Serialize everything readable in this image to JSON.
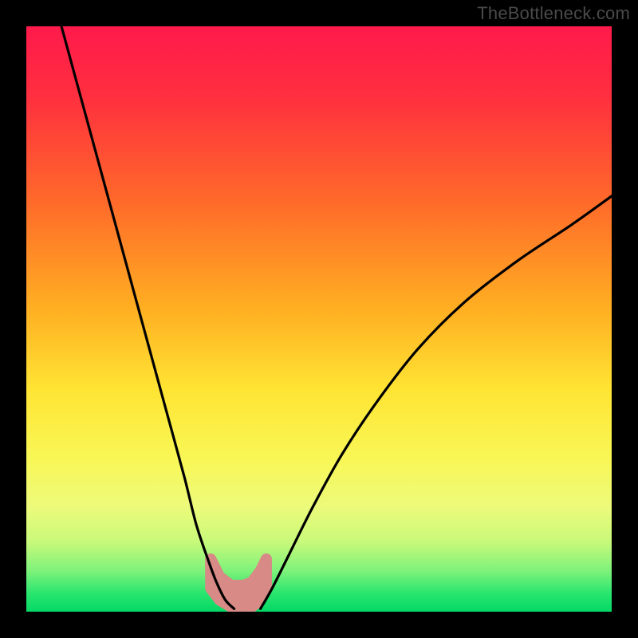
{
  "watermark": "TheBottleneck.com",
  "chart_data": {
    "type": "line",
    "title": "",
    "xlabel": "",
    "ylabel": "",
    "xlim": [
      0,
      100
    ],
    "ylim": [
      0,
      100
    ],
    "gradient_stops": [
      {
        "offset": 0.0,
        "color": "#ff1a4b"
      },
      {
        "offset": 0.12,
        "color": "#ff2f3f"
      },
      {
        "offset": 0.3,
        "color": "#ff6a2a"
      },
      {
        "offset": 0.48,
        "color": "#ffae22"
      },
      {
        "offset": 0.62,
        "color": "#ffe433"
      },
      {
        "offset": 0.74,
        "color": "#f8f756"
      },
      {
        "offset": 0.82,
        "color": "#edfa7a"
      },
      {
        "offset": 0.88,
        "color": "#c9f97a"
      },
      {
        "offset": 0.93,
        "color": "#7ef27b"
      },
      {
        "offset": 0.97,
        "color": "#27e56e"
      },
      {
        "offset": 1.0,
        "color": "#05d865"
      }
    ],
    "series": [
      {
        "name": "left-curve",
        "x": [
          6,
          9,
          12,
          15,
          18,
          21,
          24,
          27,
          29,
          31,
          32.5,
          34,
          35.5
        ],
        "y": [
          100,
          89,
          78,
          67,
          56,
          45,
          34,
          23,
          15,
          9,
          5,
          2,
          0.5
        ]
      },
      {
        "name": "right-curve",
        "x": [
          40,
          42,
          45,
          49,
          54,
          60,
          67,
          75,
          84,
          93,
          100
        ],
        "y": [
          0.5,
          4,
          10,
          18,
          27,
          36,
          45,
          53,
          60,
          66,
          71
        ]
      }
    ],
    "valley_band": {
      "color": "#d88a86",
      "x": [
        31.5,
        33,
        35,
        37,
        38.5,
        40,
        41
      ],
      "y_top": [
        9,
        6,
        4.5,
        4.5,
        5,
        7,
        9
      ],
      "y_bottom": [
        4,
        2,
        0.8,
        0.6,
        0.8,
        2,
        4
      ]
    }
  }
}
